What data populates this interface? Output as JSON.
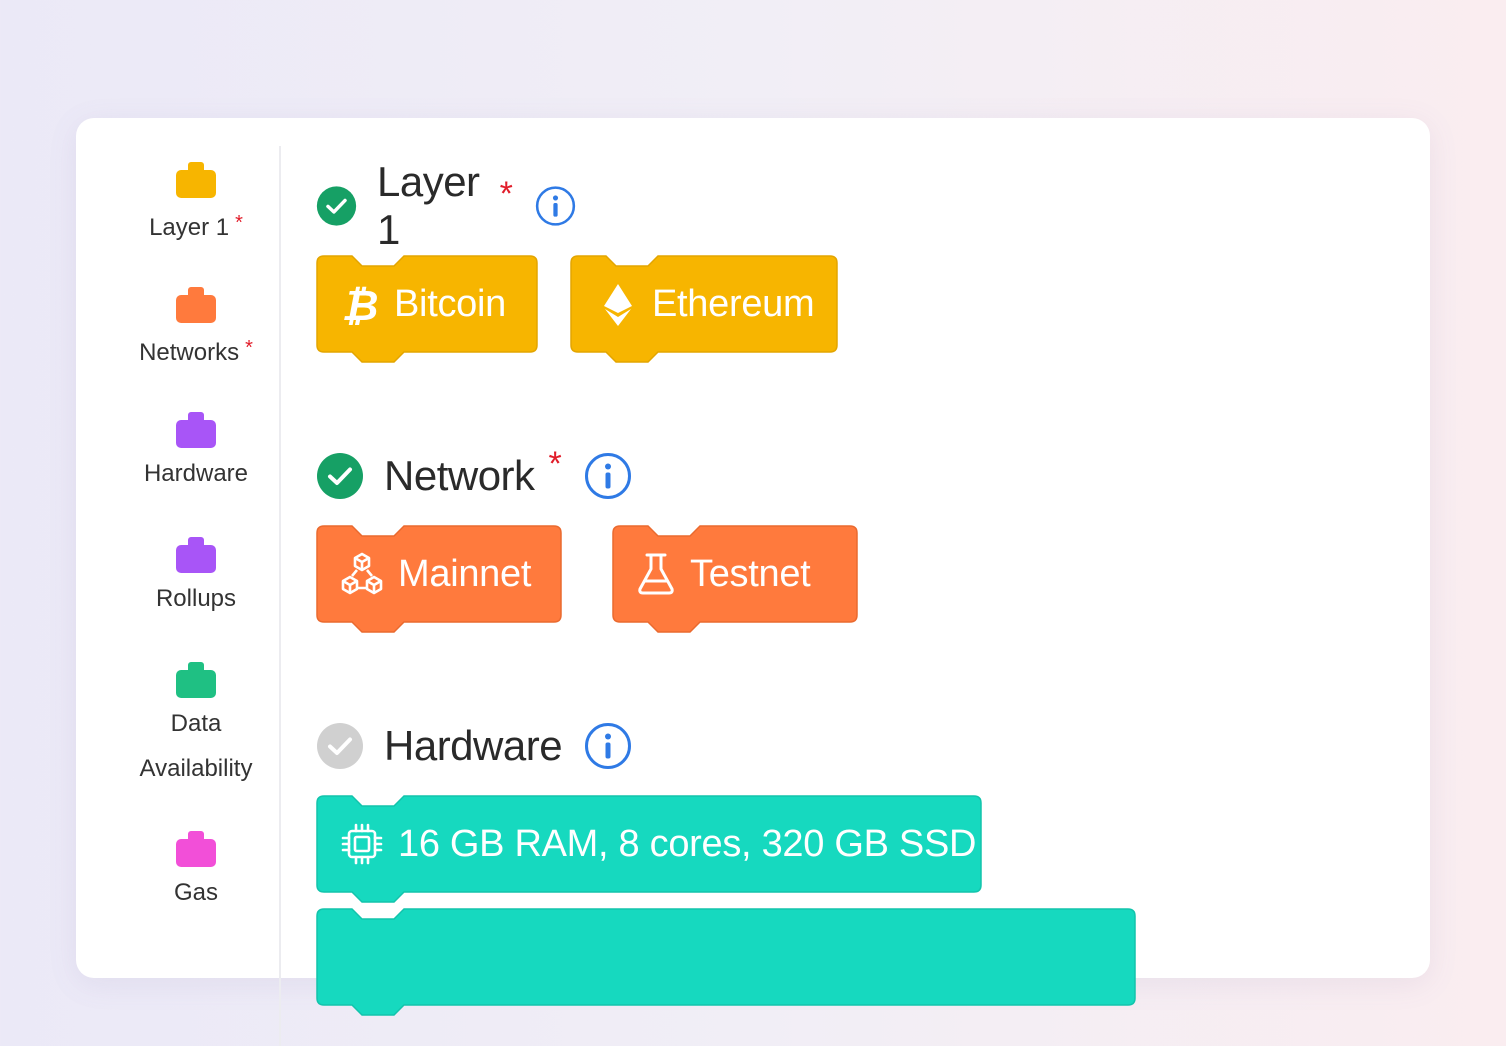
{
  "colors": {
    "layer1": "#f7b500",
    "networks": "#ff7a3d",
    "hardware": "#a855f7",
    "rollups": "#a855f7",
    "data_availability": "#1fc083",
    "gas": "#f24fd8",
    "hardware_pill": "#16d9bf",
    "check_done": "#16a065",
    "check_pending": "#d0d0d0",
    "info": "#2f7ae5",
    "required": "#e11d2a"
  },
  "sidebar": {
    "items": [
      {
        "label": "Layer 1",
        "required": "*",
        "icon": "block-icon"
      },
      {
        "label": "Networks",
        "required": "*",
        "icon": "block-icon"
      },
      {
        "label": "Hardware",
        "icon": "block-icon"
      },
      {
        "label": "Rollups",
        "icon": "block-icon"
      },
      {
        "label_line1": "Data",
        "label_line2": "Availability",
        "icon": "block-icon"
      },
      {
        "label": "Gas",
        "icon": "block-icon"
      }
    ]
  },
  "sections": [
    {
      "title": "Layer 1",
      "required": "*",
      "status": "complete",
      "options": [
        {
          "label": "Bitcoin",
          "icon": "bitcoin-icon"
        },
        {
          "label": "Ethereum",
          "icon": "ethereum-icon"
        }
      ]
    },
    {
      "title": "Network",
      "required": "*",
      "status": "complete",
      "options": [
        {
          "label": "Mainnet",
          "icon": "network-cubes-icon"
        },
        {
          "label": "Testnet",
          "icon": "flask-icon"
        }
      ]
    },
    {
      "title": "Hardware",
      "status": "incomplete",
      "options": [
        {
          "label": "16 GB RAM, 8 cores, 320 GB SSD",
          "icon": "cpu-icon"
        }
      ]
    }
  ]
}
